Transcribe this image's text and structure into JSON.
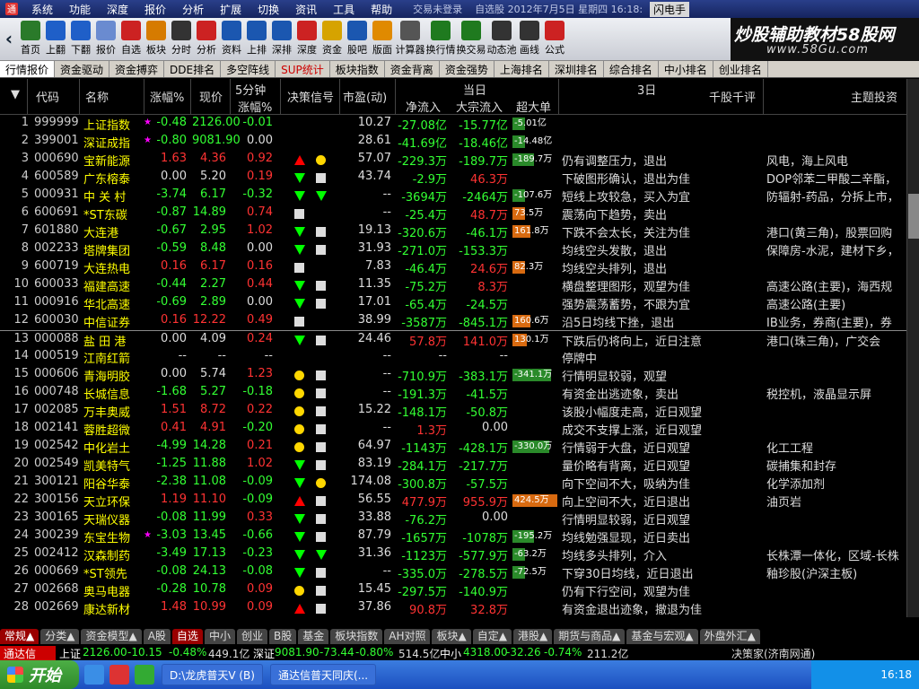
{
  "menubar": {
    "items": [
      "系统",
      "功能",
      "深度",
      "报价",
      "分析",
      "扩展",
      "切换",
      "资讯",
      "工具",
      "帮助"
    ],
    "status": "交易未登录",
    "date_info": "自选股 2012年7月5日 星期四 16:18:",
    "badge": "闪电手"
  },
  "toolbar": {
    "nav_back": "‹",
    "nav_forward": "›",
    "buttons": [
      {
        "label": "首页",
        "icon": "home-icon",
        "color": "#2a7a2a"
      },
      {
        "label": "上翻",
        "icon": "arrow-up-icon",
        "color": "#1f5fc8"
      },
      {
        "label": "下翻",
        "icon": "arrow-down-icon",
        "color": "#1f5fc8"
      },
      {
        "label": "报价",
        "icon": "yen-icon",
        "color": "#6a8bd0"
      },
      {
        "label": "自选",
        "icon": "f6-icon",
        "color": "#c22"
      },
      {
        "label": "板块",
        "icon": "pie-icon",
        "color": "#d67b00"
      },
      {
        "label": "分时",
        "icon": "line-chart-icon",
        "color": "#333"
      },
      {
        "label": "分析",
        "icon": "kline-icon",
        "color": "#c22"
      },
      {
        "label": "资料",
        "icon": "doc-icon",
        "color": "#1b57b0"
      },
      {
        "label": "上排",
        "icon": "sort-up-icon",
        "color": "#1b57b0"
      },
      {
        "label": "深排",
        "icon": "sort-down-icon",
        "color": "#1b57b0"
      },
      {
        "label": "深度",
        "icon": "f9-icon",
        "color": "#c22"
      },
      {
        "label": "资金",
        "icon": "fund-icon",
        "color": "#d6a300"
      },
      {
        "label": "股吧",
        "icon": "users-icon",
        "color": "#1b57b0"
      },
      {
        "label": "版面",
        "icon": "l2-icon",
        "color": "#e08a00"
      },
      {
        "label": "计算器",
        "icon": "calculator-icon",
        "color": "#555"
      },
      {
        "label": "换行情",
        "icon": "switch-quote-icon",
        "color": "#1f7a1f"
      },
      {
        "label": "换交易",
        "icon": "switch-trade-icon",
        "color": "#1f7a1f"
      },
      {
        "label": "动态池",
        "icon": "pool-icon",
        "color": "#333"
      },
      {
        "label": "画线",
        "icon": "pen-icon",
        "color": "#333"
      },
      {
        "label": "公式",
        "icon": "formula-icon",
        "color": "#c22"
      }
    ],
    "extra_labels": [
      "参数",
      "闪电",
      "委托",
      "交易",
      "买入",
      "卖出"
    ]
  },
  "brand": {
    "line1": "炒股辅助教材58股网",
    "line2": "www.58Gu.com"
  },
  "top_tabs": [
    "行情报价",
    "资金驱动",
    "资金搏弈",
    "DDE排名",
    "多空阵线",
    "SUP统计",
    "板块指数",
    "资金背离",
    "资金强势",
    "上海排名",
    "深圳排名",
    "综合排名",
    "中小排名",
    "创业排名"
  ],
  "headers": {
    "code": "代码",
    "name": "名称",
    "chg": "涨幅%",
    "price": "现价",
    "five_min": "5分钟",
    "five_min_sub": "涨幅%",
    "signal": "决策信号",
    "pe": "市盈(动)",
    "today": "当日",
    "net_inflow": "净流入",
    "block_inflow": "大宗流入",
    "super_big": "超大单",
    "three_day": "3日",
    "comment": "千股千评",
    "theme": "主题投资"
  },
  "rows": [
    {
      "i": "1",
      "code": "999999",
      "name": "上证指数",
      "mark": "★",
      "chg": "-0.48",
      "px": "2126.00",
      "m5": "-0.01",
      "s1": "",
      "s2": "",
      "pe": "10.27",
      "nf": "-27.08亿",
      "bf": "-15.77亿",
      "bar": {
        "v": -5,
        "label": "-5.01亿",
        "c": "#2a8a2a"
      },
      "cm": "",
      "th": ""
    },
    {
      "i": "2",
      "code": "399001",
      "name": "深证成指",
      "mark": "★",
      "chg": "-0.80",
      "px": "9081.90",
      "m5": "0.00",
      "s1": "",
      "s2": "",
      "pe": "28.61",
      "nf": "-41.69亿",
      "bf": "-18.46亿",
      "bar": {
        "v": -14,
        "label": "-14.48亿",
        "c": "#2a8a2a"
      },
      "cm": "",
      "th": ""
    },
    {
      "i": "3",
      "code": "000690",
      "name": "宝新能源",
      "chg": "1.63",
      "px": "4.36",
      "m5": "0.92",
      "s1": "up",
      "s2": "dot",
      "pe": "57.07",
      "nf": "-229.3万",
      "bf": "-189.7万",
      "bar": {
        "v": -189,
        "label": "-189.7万",
        "c": "#2a8a2a"
      },
      "cm": "仍有调整压力，退出",
      "th": "风电，海上风电"
    },
    {
      "i": "4",
      "code": "600589",
      "name": "广东榕泰",
      "chg": "0.00",
      "px": "5.20",
      "m5": "0.19",
      "s1": "dn",
      "s2": "sq",
      "pe": "43.74",
      "nf": "-2.9万",
      "bf": "46.3万",
      "bar": {
        "v": 0,
        "label": "",
        "c": "#2a8a2a"
      },
      "cm": "下破图形确认，退出为佳",
      "th": "DOP邻苯二甲酸二辛酯，"
    },
    {
      "i": "5",
      "code": "000931",
      "name": "中 关 村",
      "chg": "-3.74",
      "px": "6.17",
      "m5": "-0.32",
      "s1": "dn",
      "s2": "dn",
      "pe": "--",
      "nf": "-3694万",
      "bf": "-2464万",
      "bar": {
        "v": -107,
        "label": "-107.6万",
        "c": "#2a8a2a"
      },
      "cm": "短线上攻较急，买入为宜",
      "th": "防辐射-药品，分拆上市，"
    },
    {
      "i": "6",
      "code": "600691",
      "name": "*ST东碳",
      "chg": "-0.87",
      "px": "14.89",
      "m5": "0.74",
      "s1": "sq",
      "s2": "",
      "pe": "--",
      "nf": "-25.4万",
      "bf": "48.7万",
      "bar": {
        "v": 73,
        "label": "73.5万",
        "c": "#d86a10"
      },
      "cm": "震荡向下趋势，卖出",
      "th": ""
    },
    {
      "i": "7",
      "code": "601880",
      "name": "大连港",
      "chg": "-0.67",
      "px": "2.95",
      "m5": "1.02",
      "s1": "dn",
      "s2": "sq",
      "pe": "19.13",
      "nf": "-320.6万",
      "bf": "-46.1万",
      "bar": {
        "v": 161,
        "label": "161.8万",
        "c": "#d86a10"
      },
      "cm": "下跌不会太长，关注为佳",
      "th": "港口(黄三角)，股票回购"
    },
    {
      "i": "8",
      "code": "002233",
      "name": "塔牌集团",
      "chg": "-0.59",
      "px": "8.48",
      "m5": "0.00",
      "s1": "dn",
      "s2": "sq",
      "pe": "31.93",
      "nf": "-271.0万",
      "bf": "-153.3万",
      "bar": {
        "v": 0,
        "label": "",
        "c": "#2a8a2a"
      },
      "cm": "均线空头发散，退出",
      "th": "保障房-水泥，建材下乡，"
    },
    {
      "i": "9",
      "code": "600719",
      "name": "大连热电",
      "chg": "0.16",
      "px": "6.17",
      "m5": "0.16",
      "s1": "sq",
      "s2": "",
      "pe": "7.83",
      "nf": "-46.4万",
      "bf": "24.6万",
      "bar": {
        "v": 82,
        "label": "82.3万",
        "c": "#d86a10"
      },
      "cm": "均线空头排列，退出",
      "th": ""
    },
    {
      "i": "10",
      "code": "600033",
      "name": "福建高速",
      "chg": "-0.44",
      "px": "2.27",
      "m5": "0.44",
      "s1": "dn",
      "s2": "sq",
      "pe": "11.35",
      "nf": "-75.2万",
      "bf": "8.3万",
      "bar": {
        "v": 0,
        "label": "",
        "c": "#2a8a2a"
      },
      "cm": "横盘整理图形，观望为佳",
      "th": "高速公路(主要)，海西规"
    },
    {
      "i": "11",
      "code": "000916",
      "name": "华北高速",
      "chg": "-0.69",
      "px": "2.89",
      "m5": "0.00",
      "s1": "dn",
      "s2": "sq",
      "pe": "17.01",
      "nf": "-65.4万",
      "bf": "-24.5万",
      "bar": {
        "v": 0,
        "label": "",
        "c": "#2a8a2a"
      },
      "cm": "强势震荡蓄势，不跟为宜",
      "th": "高速公路(主要)"
    },
    {
      "i": "12",
      "code": "600030",
      "name": "中信证券",
      "chg": "0.16",
      "px": "12.22",
      "m5": "0.49",
      "s1": "sq",
      "s2": "",
      "pe": "38.99",
      "nf": "-3587万",
      "bf": "-845.1万",
      "bar": {
        "v": 160,
        "label": "160.6万",
        "c": "#d86a10"
      },
      "cm": "沿5日均线下挫，退出",
      "th": "IB业务，券商(主要)，券"
    },
    {
      "i": "13",
      "code": "000088",
      "name": "盐 田 港",
      "chg": "0.00",
      "px": "4.09",
      "m5": "0.24",
      "s1": "dn",
      "s2": "sq",
      "pe": "24.46",
      "nf": "57.8万",
      "bf": "141.0万",
      "bar": {
        "v": 130,
        "label": "130.1万",
        "c": "#d86a10"
      },
      "cm": "下跌后仍将向上，近日注意",
      "th": "港口(珠三角)，广交会"
    },
    {
      "i": "14",
      "code": "000519",
      "name": "江南红箭",
      "chg": "--",
      "px": "--",
      "m5": "--",
      "s1": "",
      "s2": "",
      "pe": "--",
      "nf": "--",
      "bf": "--",
      "bar": {
        "v": 0,
        "label": "",
        "c": "#2a8a2a"
      },
      "cm": "停牌中",
      "th": ""
    },
    {
      "i": "15",
      "code": "000606",
      "name": "青海明胶",
      "chg": "0.00",
      "px": "5.74",
      "m5": "1.23",
      "s1": "dot",
      "s2": "sq",
      "pe": "--",
      "nf": "-710.9万",
      "bf": "-383.1万",
      "bar": {
        "v": -341,
        "label": "-341.1万",
        "c": "#2a8a2a"
      },
      "cm": "行情明显较弱，观望",
      "th": ""
    },
    {
      "i": "16",
      "code": "000748",
      "name": "长城信息",
      "chg": "-1.68",
      "px": "5.27",
      "m5": "-0.18",
      "s1": "dot",
      "s2": "sq",
      "pe": "--",
      "nf": "-191.3万",
      "bf": "-41.5万",
      "bar": {
        "v": 0,
        "label": "",
        "c": "#2a8a2a"
      },
      "cm": "有资金出逃迹象，卖出",
      "th": "税控机，液晶显示屏"
    },
    {
      "i": "17",
      "code": "002085",
      "name": "万丰奥威",
      "chg": "1.51",
      "px": "8.72",
      "m5": "0.22",
      "s1": "dot",
      "s2": "sq",
      "pe": "15.22",
      "nf": "-148.1万",
      "bf": "-50.8万",
      "bar": {
        "v": 0,
        "label": "",
        "c": "#2a8a2a"
      },
      "cm": "该股小幅度走高，近日观望",
      "th": ""
    },
    {
      "i": "18",
      "code": "002141",
      "name": "蓉胜超微",
      "chg": "0.41",
      "px": "4.91",
      "m5": "-0.20",
      "s1": "dot",
      "s2": "sq",
      "pe": "--",
      "nf": "1.3万",
      "bf": "0.00",
      "bar": {
        "v": 0,
        "label": "",
        "c": "#2a8a2a"
      },
      "cm": "成交不支撑上涨，近日观望",
      "th": ""
    },
    {
      "i": "19",
      "code": "002542",
      "name": "中化岩土",
      "chg": "-4.99",
      "px": "14.28",
      "m5": "0.21",
      "s1": "dot",
      "s2": "sq",
      "pe": "64.97",
      "nf": "-1143万",
      "bf": "-428.1万",
      "bar": {
        "v": -330,
        "label": "-330.0万",
        "c": "#2a8a2a"
      },
      "cm": "行情弱于大盘，近日观望",
      "th": "化工工程"
    },
    {
      "i": "20",
      "code": "002549",
      "name": "凯美特气",
      "chg": "-1.25",
      "px": "11.88",
      "m5": "1.02",
      "s1": "dn",
      "s2": "sq",
      "pe": "83.19",
      "nf": "-284.1万",
      "bf": "-217.7万",
      "bar": {
        "v": 0,
        "label": "",
        "c": "#2a8a2a"
      },
      "cm": "量价略有背离，近日观望",
      "th": "碳捕集和封存"
    },
    {
      "i": "21",
      "code": "300121",
      "name": "阳谷华泰",
      "chg": "-2.38",
      "px": "11.08",
      "m5": "-0.09",
      "s1": "dn",
      "s2": "dot",
      "pe": "174.08",
      "nf": "-300.8万",
      "bf": "-57.5万",
      "bar": {
        "v": 0,
        "label": "",
        "c": "#2a8a2a"
      },
      "cm": "向下空间不大，吸纳为佳",
      "th": "化学添加剂"
    },
    {
      "i": "22",
      "code": "300156",
      "name": "天立环保",
      "chg": "1.19",
      "px": "11.10",
      "m5": "-0.09",
      "s1": "up",
      "s2": "sq",
      "pe": "56.55",
      "nf": "477.9万",
      "bf": "955.9万",
      "bar": {
        "v": 424,
        "label": "424.5万",
        "c": "#d86a10"
      },
      "cm": "向上空间不大，近日退出",
      "th": "油页岩"
    },
    {
      "i": "23",
      "code": "300165",
      "name": "天瑞仪器",
      "chg": "-0.08",
      "px": "11.99",
      "m5": "0.33",
      "s1": "dn",
      "s2": "sq",
      "pe": "33.88",
      "nf": "-76.2万",
      "bf": "0.00",
      "bar": {
        "v": 0,
        "label": "",
        "c": "#2a8a2a"
      },
      "cm": "行情明显较弱，近日观望",
      "th": ""
    },
    {
      "i": "24",
      "code": "300239",
      "name": "东宝生物",
      "mark": "★",
      "chg": "-3.03",
      "px": "13.45",
      "m5": "-0.66",
      "s1": "dn",
      "s2": "sq",
      "pe": "87.79",
      "nf": "-1657万",
      "bf": "-1078万",
      "bar": {
        "v": -195,
        "label": "-195.2万",
        "c": "#2a8a2a"
      },
      "cm": "均线勉强显现，近日卖出",
      "th": ""
    },
    {
      "i": "25",
      "code": "002412",
      "name": "汉森制药",
      "chg": "-3.49",
      "px": "17.13",
      "m5": "-0.23",
      "s1": "dn",
      "s2": "dn",
      "pe": "31.36",
      "nf": "-1123万",
      "bf": "-577.9万",
      "bar": {
        "v": -63,
        "label": "-63.2万",
        "c": "#2a8a2a"
      },
      "cm": "均线多头排列，介入",
      "th": "长株潭一体化，区域-长株"
    },
    {
      "i": "26",
      "code": "000669",
      "name": "*ST领先",
      "chg": "-0.08",
      "px": "24.13",
      "m5": "-0.08",
      "s1": "dn",
      "s2": "sq",
      "pe": "--",
      "nf": "-335.0万",
      "bf": "-278.5万",
      "bar": {
        "v": -72,
        "label": "-72.5万",
        "c": "#2a8a2a"
      },
      "cm": "下穿30日均线，近日退出",
      "th": "釉珍股(沪深主板)"
    },
    {
      "i": "27",
      "code": "002668",
      "name": "奥马电器",
      "chg": "-0.28",
      "px": "10.78",
      "m5": "0.09",
      "s1": "dot",
      "s2": "sq",
      "pe": "15.45",
      "nf": "-297.5万",
      "bf": "-140.9万",
      "bar": {
        "v": 0,
        "label": "",
        "c": "#2a8a2a"
      },
      "cm": "仍有下行空间，观望为佳",
      "th": ""
    },
    {
      "i": "28",
      "code": "002669",
      "name": "康达新材",
      "chg": "1.48",
      "px": "10.99",
      "m5": "0.09",
      "s1": "up",
      "s2": "sq",
      "pe": "37.86",
      "nf": "90.8万",
      "bf": "32.8万",
      "bar": {
        "v": 0,
        "label": "",
        "c": "#2a8a2a"
      },
      "cm": "有资金退出迹象，撤退为佳",
      "th": ""
    }
  ],
  "bottom_tabs": [
    "常规▲",
    "分类▲",
    "资金模型▲",
    "A股",
    "自选",
    "中小",
    "创业",
    "B股",
    "基金",
    "板块指数",
    "AH对照",
    "板块▲",
    "自定▲",
    "港股▲",
    "期货与商品▲",
    "基金与宏观▲",
    "外盘外汇▲"
  ],
  "ticker": {
    "label": "通达信",
    "sh_name": "上证",
    "sh_val": "2126.00",
    "sh_chg": "-10.15",
    "sh_pct": "-0.48%",
    "sh_amt": "449.1亿",
    "sz_name": "深证",
    "sz_val": "9081.90",
    "sz_chg": "-73.44",
    "sz_pct": "-0.80%",
    "sz_amt": "514.5亿",
    "zx_name": "中小",
    "zx_val": "4318.00",
    "zx_chg": "-32.26",
    "zx_pct": "-0.74%",
    "zx_amt": "211.2亿",
    "broker": "决策家(济南网通)"
  },
  "taskbar": {
    "start": "开始",
    "tasks": [
      "D:\\龙虎普天V (B)",
      "通达信普天同庆(..."
    ],
    "clock": "16:18"
  }
}
